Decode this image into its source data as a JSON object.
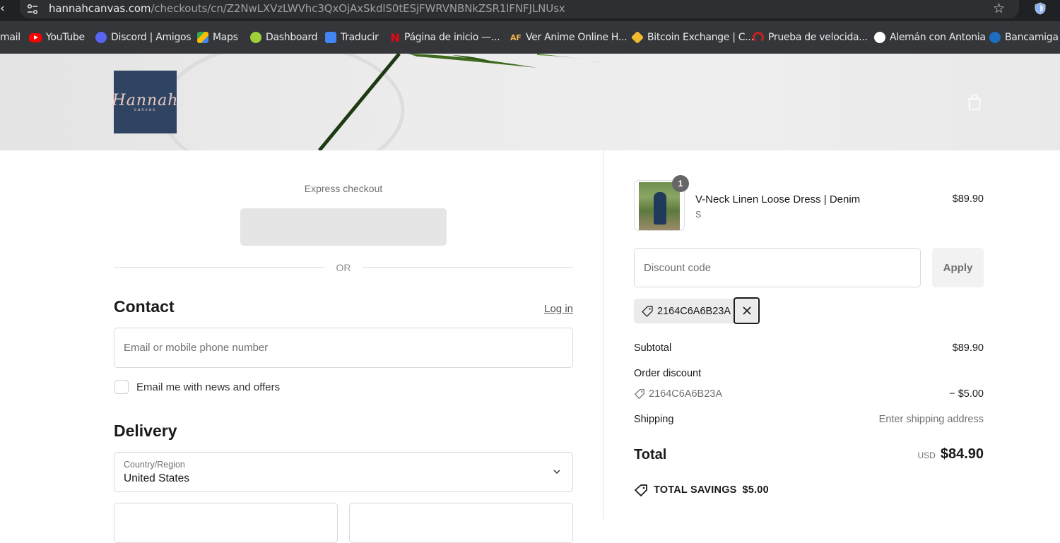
{
  "browser": {
    "url_domain": "hannahcanvas.com",
    "url_path": "/checkouts/cn/Z2NwLXVzLWVhc3QxOjAxSkdlS0tESjFWRVNBNkZSR1lFNFJLNUsx",
    "bookmarks": [
      {
        "label": "mail",
        "icon": "gmail-icon"
      },
      {
        "label": "YouTube",
        "icon": "youtube-icon"
      },
      {
        "label": "Discord | Amigos",
        "icon": "discord-icon"
      },
      {
        "label": "Maps",
        "icon": "maps-icon"
      },
      {
        "label": "Dashboard",
        "icon": "dashboard-icon"
      },
      {
        "label": "Traducir",
        "icon": "translate-icon"
      },
      {
        "label": "Página de inicio —...",
        "icon": "netflix-icon"
      },
      {
        "label": "Ver Anime Online H...",
        "icon": "animeflv-icon"
      },
      {
        "label": "Bitcoin Exchange | C...",
        "icon": "binance-icon"
      },
      {
        "label": "Prueba de velocida...",
        "icon": "speedtest-icon"
      },
      {
        "label": "Alemán con Antonia",
        "icon": "globe-icon"
      },
      {
        "label": "Bancamiga",
        "icon": "bank-icon"
      }
    ]
  },
  "store": {
    "logo_text": "Hannah",
    "logo_sub": "canvas"
  },
  "checkout": {
    "express_label": "Express checkout",
    "or_label": "OR",
    "contact_title": "Contact",
    "login_label": "Log in",
    "email_placeholder": "Email or mobile phone number",
    "newsletter_label": "Email me with news and offers",
    "delivery_title": "Delivery",
    "country_label": "Country/Region",
    "country_value": "United States"
  },
  "summary": {
    "item": {
      "name": "V-Neck Linen Loose Dress | Denim",
      "variant": "S",
      "price": "$89.90",
      "quantity": "1"
    },
    "discount_placeholder": "Discount code",
    "apply_label": "Apply",
    "applied_code": "2164C6A6B23A",
    "subtotal_label": "Subtotal",
    "subtotal_value": "$89.90",
    "order_discount_label": "Order discount",
    "order_discount_code": "2164C6A6B23A",
    "order_discount_value": "− $5.00",
    "shipping_label": "Shipping",
    "shipping_value": "Enter shipping address",
    "total_label": "Total",
    "currency": "USD",
    "total_value": "$84.90",
    "savings_label": "TOTAL SAVINGS",
    "savings_value": "$5.00"
  }
}
